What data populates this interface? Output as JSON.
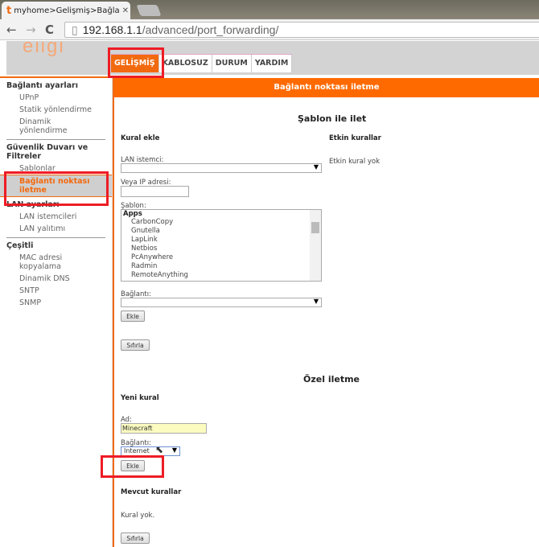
{
  "browser": {
    "tab_title": "myhome>Gelişmiş>Bağla",
    "tab_logo": "t",
    "url_host": "192.168.1.1",
    "url_path": "/advanced/port_forwarding/"
  },
  "brand": "eligi",
  "nav_tabs": [
    {
      "label": "GELİŞMİŞ",
      "active": true
    },
    {
      "label": "KABLOSUZ"
    },
    {
      "label": "DURUM"
    },
    {
      "label": "YARDIM"
    }
  ],
  "sidebar": {
    "sections": [
      {
        "title": "Bağlantı ayarları",
        "items": [
          "UPnP",
          "Statik yönlendirme",
          "Dinamik yönlendirme"
        ]
      },
      {
        "title": "Güvenlik Duvarı ve Filtreler",
        "items": [
          "Şablonlar",
          "Bağlantı noktası iletme"
        ]
      },
      {
        "title": "LAN ayarları",
        "items": [
          "LAN istemcileri",
          "LAN yalıtımı"
        ]
      },
      {
        "title": "Çeşitli",
        "items": [
          "MAC adresi kopyalama",
          "Dinamik DNS",
          "SNTP",
          "SNMP"
        ]
      }
    ]
  },
  "page_title": "Bağlantı noktası iletme",
  "template": {
    "title": "Şablon ile ilet",
    "add_rule": "Kural ekle",
    "lan_client_label": "LAN istemci:",
    "ip_label": "Veya IP adresi:",
    "ip_value": "",
    "template_label": "Şablon:",
    "group": "Apps",
    "options": [
      "CarbonCopy",
      "Gnutella",
      "LapLink",
      "Netbios",
      "PcAnywhere",
      "Radmin",
      "RemoteAnything"
    ],
    "connection_label": "Bağlantı:",
    "add_button": "Ekle",
    "reset_button": "Sıfırla",
    "active_rules_title": "Etkin kurallar",
    "active_rules_empty": "Etkin kural yok"
  },
  "custom": {
    "title": "Özel iletme",
    "new_rule": "Yeni kural",
    "name_label": "Ad:",
    "name_value": "Minecraft",
    "connection_label": "Bağlantı:",
    "connection_value": "Internet",
    "add_button": "Ekle",
    "existing_title": "Mevcut kurallar",
    "existing_empty": "Kural yok.",
    "reset_button": "Sıfırla"
  },
  "colors": {
    "accent": "#ff6a00",
    "highlight": "#ee1c25"
  }
}
